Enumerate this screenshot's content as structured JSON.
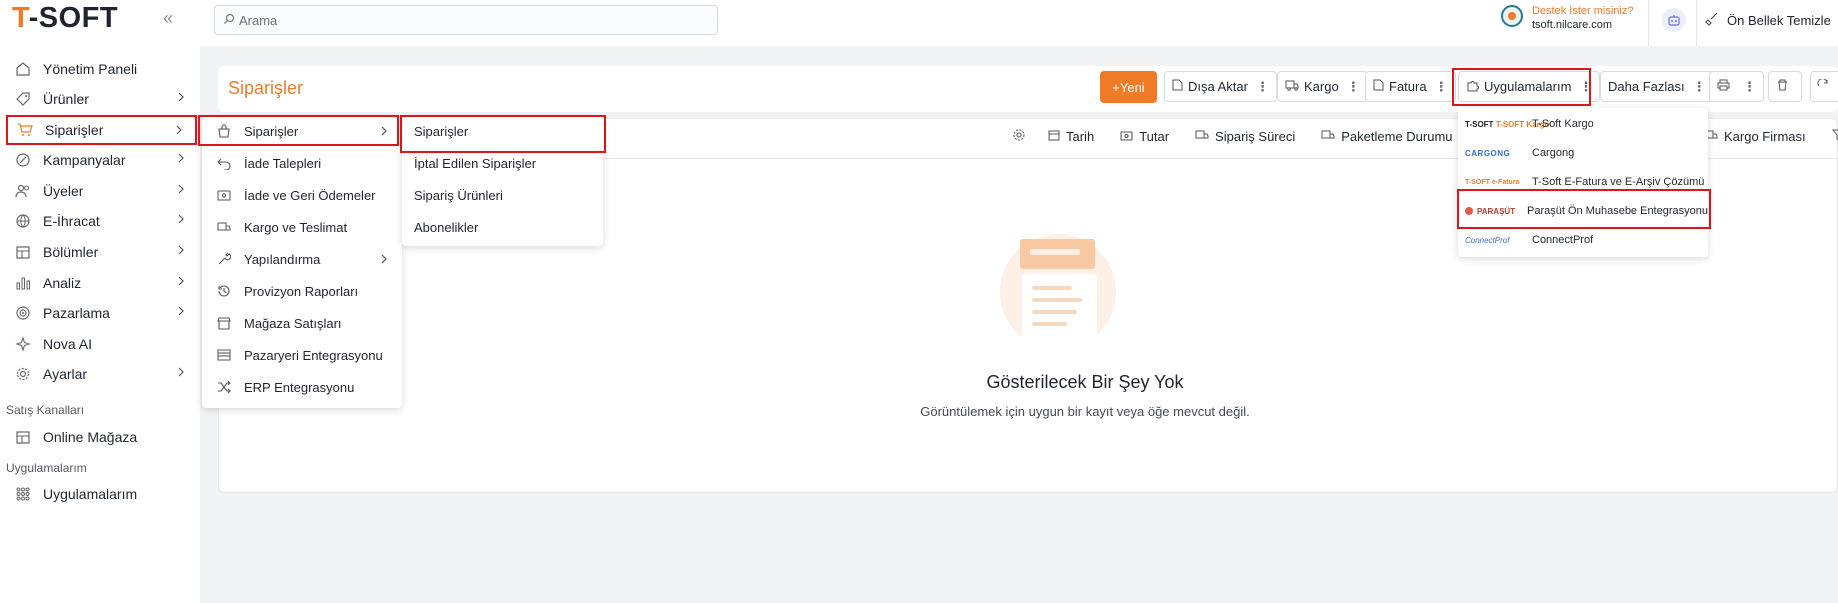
{
  "brand": {
    "logo_t": "T",
    "logo_rest": "-SOFT"
  },
  "search": {
    "placeholder": "Arama"
  },
  "support": {
    "line1": "Destek İster misiniz?",
    "line2": "tsoft.nilcare.com"
  },
  "header": {
    "cache_label": "Ön Bellek Temizle"
  },
  "sidebar": {
    "items": [
      {
        "label": "Yönetim Paneli"
      },
      {
        "label": "Ürünler"
      },
      {
        "label": "Siparişler"
      },
      {
        "label": "Kampanyalar"
      },
      {
        "label": "Üyeler"
      },
      {
        "label": "E-İhracat"
      },
      {
        "label": "Bölümler"
      },
      {
        "label": "Analiz"
      },
      {
        "label": "Pazarlama"
      },
      {
        "label": "Nova AI"
      },
      {
        "label": "Ayarlar"
      }
    ],
    "sales_section": "Satış Kanalları",
    "sales_item": "Online Mağaza",
    "apps_section": "Uygulamalarım",
    "apps_item": "Uygulamalarım"
  },
  "page": {
    "title": "Siparişler"
  },
  "toolbar": {
    "new": "+Yeni",
    "export": "Dışa Aktar",
    "cargo": "Kargo",
    "invoice": "Fatura",
    "apps": "Uygulamalarım",
    "more": "Daha Fazlası"
  },
  "filters": [
    "Tarih",
    "Tutar",
    "Sipariş Süreci",
    "Paketleme Durumu",
    "Kargo Firması"
  ],
  "submenu1": [
    "Siparişler",
    "İade Talepleri",
    "İade ve Geri Ödemeler",
    "Kargo ve Teslimat",
    "Yapılandırma",
    "Provizyon Raporları",
    "Mağaza Satışları",
    "Pazaryeri Entegrasyonu",
    "ERP Entegrasyonu"
  ],
  "submenu2": [
    "Siparişler",
    "İptal Edilen Siparişler",
    "Sipariş Ürünleri",
    "Abonelikler"
  ],
  "apps_menu": [
    {
      "logo": "T-SOFT Kargo",
      "label": "T-Soft Kargo"
    },
    {
      "logo": "CARGONG",
      "label": "Cargong"
    },
    {
      "logo": "T-SOFT e-Fatura",
      "label": "T-Soft E-Fatura ve E-Arşiv Çözümü"
    },
    {
      "logo": "PARAŞÜT",
      "label": "Paraşüt Ön Muhasebe Entegrasyonu"
    },
    {
      "logo": "ConnectProf",
      "label": "ConnectProf"
    }
  ],
  "empty": {
    "title": "Gösterilecek Bir Şey Yok",
    "subtitle": "Görüntülemek için uygun bir kayıt veya öğe mevcut değil."
  },
  "colors": {
    "accent": "#f07a26",
    "highlight": "#e0141b"
  }
}
